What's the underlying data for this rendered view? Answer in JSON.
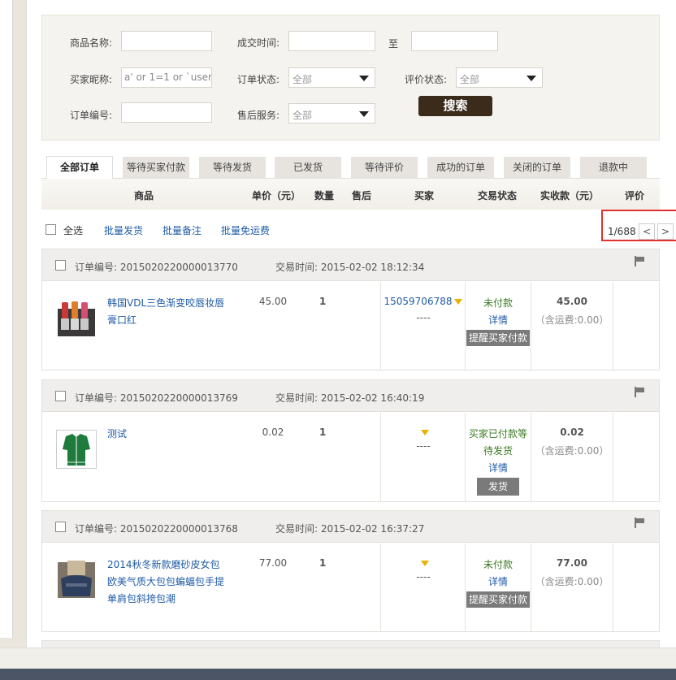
{
  "search": {
    "product_name_label": "商品名称:",
    "deal_time_label": "成交时间:",
    "to_label": "至",
    "buyer_nick_label": "买家昵称:",
    "buyer_nick_value": "a' or 1=1 or `user",
    "order_status_label": "订单状态:",
    "order_status_value": "全部",
    "review_status_label": "评价状态:",
    "review_status_value": "全部",
    "order_no_label": "订单编号:",
    "after_sale_label": "售后服务:",
    "after_sale_value": "全部",
    "search_button": "搜索"
  },
  "tabs": [
    "全部订单",
    "等待买家付款",
    "等待发货",
    "已发货",
    "等待评价",
    "成功的订单",
    "关闭的订单",
    "退款中"
  ],
  "table_headers": {
    "product": "商品",
    "unit_price": "单价（元）",
    "quantity": "数量",
    "after_sale": "售后",
    "buyer": "买家",
    "trade_status": "交易状态",
    "paid_amount": "实收款（元）",
    "review": "评价"
  },
  "toolbar": {
    "select_all": "全选",
    "batch_ship": "批量发货",
    "batch_note": "批量备注",
    "batch_free_shipping": "批量免运费",
    "page": "1/688",
    "prev": "<",
    "next": ">"
  },
  "orders": [
    {
      "order_no_label": "订单编号:",
      "order_no": "2015020220000013770",
      "time_label": "交易时间:",
      "time": "2015-02-02 18:12:34",
      "product_name": "韩国VDL三色渐变咬唇妆唇膏口红",
      "price": "45.00",
      "qty": "1",
      "buyer": "15059706788",
      "buyer_sub": "----",
      "status": "未付款",
      "detail": "详情",
      "action": "提醒买家付款",
      "amount": "45.00",
      "freight": "（含运费:0.00）"
    },
    {
      "order_no_label": "订单编号:",
      "order_no": "2015020220000013769",
      "time_label": "交易时间:",
      "time": "2015-02-02 16:40:19",
      "product_name": "测试",
      "price": "0.02",
      "qty": "1",
      "buyer": "",
      "buyer_sub": "----",
      "status": "买家已付款等待发货",
      "detail": "详情",
      "action": "发货",
      "amount": "0.02",
      "freight": "（含运费:0.00）"
    },
    {
      "order_no_label": "订单编号:",
      "order_no": "2015020220000013768",
      "time_label": "交易时间:",
      "time": "2015-02-02 16:37:27",
      "product_name": "2014秋冬新款磨砂皮女包欧美气质大包包蝙蝠包手提单肩包斜挎包潮",
      "price": "77.00",
      "qty": "1",
      "buyer": "",
      "buyer_sub": "----",
      "status": "未付款",
      "detail": "详情",
      "action": "提醒买家付款",
      "amount": "77.00",
      "freight": "（含运费:0.00）"
    }
  ],
  "colors": {
    "link": "#1f5ba6",
    "status_green": "#3c7a22",
    "search_button": "#3a2b1a",
    "highlight": "#e23030"
  }
}
